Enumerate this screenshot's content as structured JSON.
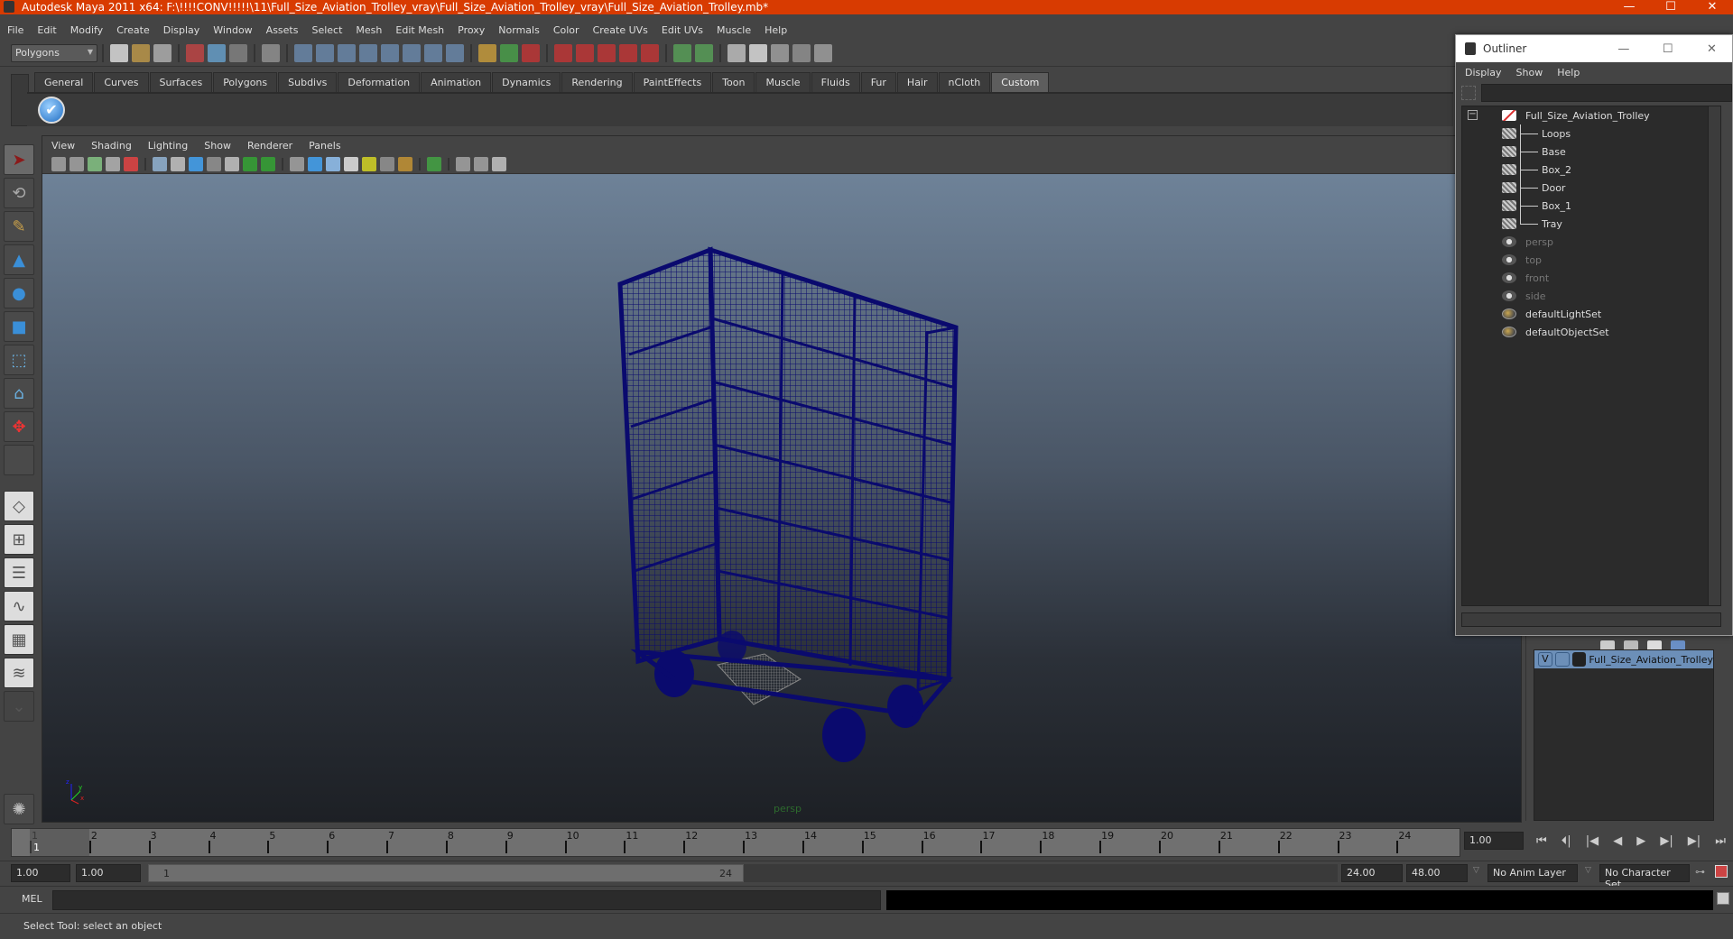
{
  "window": {
    "title": "Autodesk Maya 2011 x64: F:\\!!!!CONV!!!!!\\11\\Full_Size_Aviation_Trolley_vray\\Full_Size_Aviation_Trolley_vray\\Full_Size_Aviation_Trolley.mb*",
    "controls": {
      "minimize": "—",
      "maximize": "☐",
      "close": "✕"
    }
  },
  "menubar": [
    "File",
    "Edit",
    "Modify",
    "Create",
    "Display",
    "Window",
    "Assets",
    "Select",
    "Mesh",
    "Edit Mesh",
    "Proxy",
    "Normals",
    "Color",
    "Create UVs",
    "Edit UVs",
    "Muscle",
    "Help"
  ],
  "statusline": {
    "menuset": "Polygons",
    "icons": [
      "new-scene-icon",
      "open-scene-icon",
      "save-scene-icon",
      "select-by-hierarchy-icon",
      "select-by-object-icon",
      "select-by-component-icon",
      "mask-icon",
      "snap-grid-icon",
      "snap-curve-icon",
      "snap-point-icon",
      "snap-surface-icon",
      "snap-view-plane-icon",
      "snap-live-icon",
      "history-icon",
      "help-icon",
      "lock-icon",
      "select-highlight-icon",
      "construction-history-icon",
      "magnet-grid-icon",
      "magnet-curve-icon",
      "magnet-point-icon",
      "magnet-surface-icon",
      "magnet-live-icon",
      "input-ops-icon",
      "output-ops-icon",
      "render-history-icon",
      "render-view-icon",
      "render-current-icon",
      "ipr-render-icon",
      "render-settings-icon"
    ]
  },
  "shelf": {
    "tabs": [
      "General",
      "Curves",
      "Surfaces",
      "Polygons",
      "Subdivs",
      "Deformation",
      "Animation",
      "Dynamics",
      "Rendering",
      "PaintEffects",
      "Toon",
      "Muscle",
      "Fluids",
      "Fur",
      "Hair",
      "nCloth",
      "Custom"
    ],
    "active_tab": "Custom",
    "items": [
      {
        "icon": "checkmark-icon",
        "glyph": "✔"
      }
    ]
  },
  "toolbox": {
    "tools": [
      {
        "name": "select-tool",
        "glyph": "➤",
        "selected": true
      },
      {
        "name": "lasso-tool",
        "glyph": "⟲"
      },
      {
        "name": "paint-select-tool",
        "glyph": "✎"
      },
      {
        "name": "move-tool",
        "glyph": "▲"
      },
      {
        "name": "rotate-tool",
        "glyph": "●"
      },
      {
        "name": "scale-tool",
        "glyph": "■"
      },
      {
        "name": "universal-manipulator",
        "glyph": "⬚"
      },
      {
        "name": "soft-modification-tool",
        "glyph": "⌂"
      },
      {
        "name": "show-manipulator-tool",
        "glyph": "✥"
      },
      {
        "name": "last-tool",
        "glyph": ""
      },
      {
        "name": "single-perspective-layout",
        "glyph": "◇"
      },
      {
        "name": "four-view-layout",
        "glyph": "⊞"
      },
      {
        "name": "outliner-persp-layout",
        "glyph": "☰"
      },
      {
        "name": "persp-graph-layout",
        "glyph": "∿"
      },
      {
        "name": "hypershade-persp-layout",
        "glyph": "▦"
      },
      {
        "name": "persp-outliner-graph-layout",
        "glyph": "≋"
      },
      {
        "name": "layout-menu",
        "glyph": "⌄"
      }
    ]
  },
  "panel": {
    "menus": [
      "View",
      "Shading",
      "Lighting",
      "Show",
      "Renderer",
      "Panels"
    ],
    "camera_label": "persp",
    "axis_labels": {
      "x": "x",
      "y": "y",
      "z": "z"
    }
  },
  "timeline": {
    "ticks": [
      "1",
      "2",
      "3",
      "4",
      "5",
      "6",
      "7",
      "8",
      "9",
      "10",
      "11",
      "12",
      "13",
      "14",
      "15",
      "16",
      "17",
      "18",
      "19",
      "20",
      "21",
      "22",
      "23",
      "24"
    ],
    "current_marker": "1",
    "current_frame": "1.00",
    "playback_buttons": [
      {
        "name": "go-to-start-button",
        "glyph": "⏮"
      },
      {
        "name": "step-back-frame-button",
        "glyph": "⏴|"
      },
      {
        "name": "step-back-key-button",
        "glyph": "|◀"
      },
      {
        "name": "play-backwards-button",
        "glyph": "◀"
      },
      {
        "name": "play-forwards-button",
        "glyph": "▶"
      },
      {
        "name": "step-forward-key-button",
        "glyph": "▶|"
      },
      {
        "name": "step-forward-frame-button",
        "glyph": "▶|"
      },
      {
        "name": "go-to-end-button",
        "glyph": "⏭"
      }
    ]
  },
  "range": {
    "start_time": "1.00",
    "playback_start": "1.00",
    "slider_start_label": "1",
    "slider_end_label": "24",
    "playback_end": "24.00",
    "end_time": "48.00",
    "anim_layer": "No Anim Layer",
    "character_set": "No Character Set"
  },
  "commandline": {
    "label": "MEL",
    "value": ""
  },
  "helpline": {
    "text": "Select Tool: select an object"
  },
  "outliner": {
    "title": "Outliner",
    "menus": [
      "Display",
      "Show",
      "Help"
    ],
    "filter_value": "",
    "items": [
      {
        "label": "Full_Size_Aviation_Trolley",
        "icon": "transform-icon",
        "level": 0,
        "expanded": true,
        "dim": false
      },
      {
        "label": "Loops",
        "icon": "mesh-icon",
        "level": 1,
        "dim": false
      },
      {
        "label": "Base",
        "icon": "mesh-icon",
        "level": 1,
        "dim": false
      },
      {
        "label": "Box_2",
        "icon": "mesh-icon",
        "level": 1,
        "dim": false
      },
      {
        "label": "Door",
        "icon": "mesh-icon",
        "level": 1,
        "dim": false
      },
      {
        "label": "Box_1",
        "icon": "mesh-icon",
        "level": 1,
        "dim": false
      },
      {
        "label": "Tray",
        "icon": "mesh-icon",
        "level": 1,
        "dim": false
      },
      {
        "label": "persp",
        "icon": "camera-icon",
        "level": 0,
        "dim": true
      },
      {
        "label": "top",
        "icon": "camera-icon",
        "level": 0,
        "dim": true
      },
      {
        "label": "front",
        "icon": "camera-icon",
        "level": 0,
        "dim": true
      },
      {
        "label": "side",
        "icon": "camera-icon",
        "level": 0,
        "dim": true
      },
      {
        "label": "defaultLightSet",
        "icon": "set-icon",
        "level": 0,
        "dim": false
      },
      {
        "label": "defaultObjectSet",
        "icon": "set-icon",
        "level": 0,
        "dim": false
      }
    ]
  },
  "layers": {
    "rows": [
      {
        "visible": "V",
        "playback": "",
        "name": "Full_Size_Aviation_Trolley"
      }
    ]
  },
  "colors": {
    "titlebar": "#d83b01",
    "wireframe": "#0a0a6e",
    "layer_selected": "#6c8fb8"
  }
}
